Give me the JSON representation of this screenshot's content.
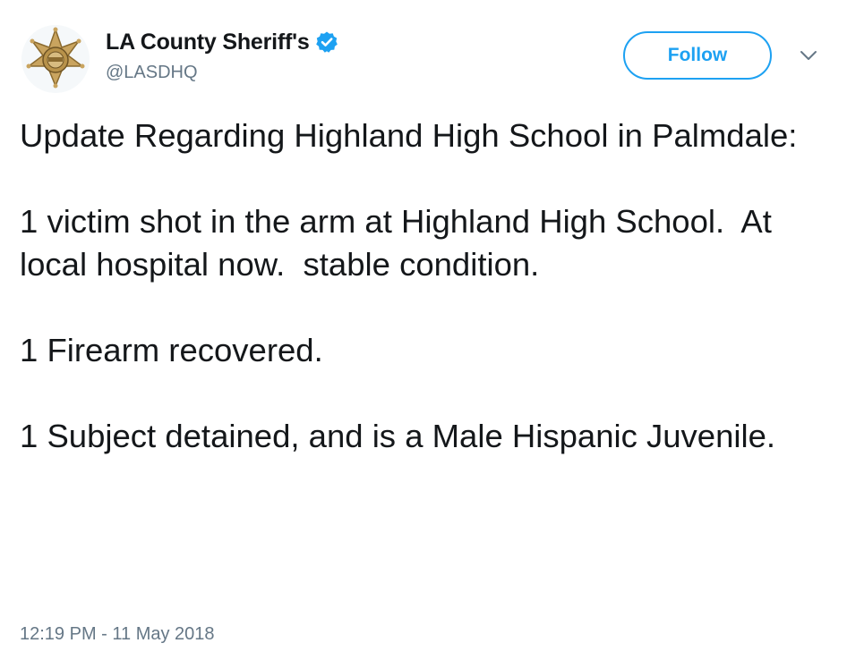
{
  "account": {
    "display_name": "LA County Sheriff's",
    "handle": "@LASDHQ",
    "verified": true,
    "avatar_icon": "sheriff-star-badge"
  },
  "actions": {
    "follow_label": "Follow",
    "more_icon": "chevron-down-icon"
  },
  "tweet": {
    "paragraphs": [
      "Update Regarding Highland High School in Palmdale:",
      "1 victim shot in the arm at Highland High School.  At local hospital now.  stable condition.",
      "1 Firearm recovered.",
      "1 Subject detained, and is a Male Hispanic Juvenile."
    ],
    "timestamp": "12:19 PM - 11 May 2018"
  },
  "colors": {
    "accent": "#1da1f2",
    "text": "#14171a",
    "secondary_text": "#657786",
    "badge_gold": "#b8924a"
  }
}
